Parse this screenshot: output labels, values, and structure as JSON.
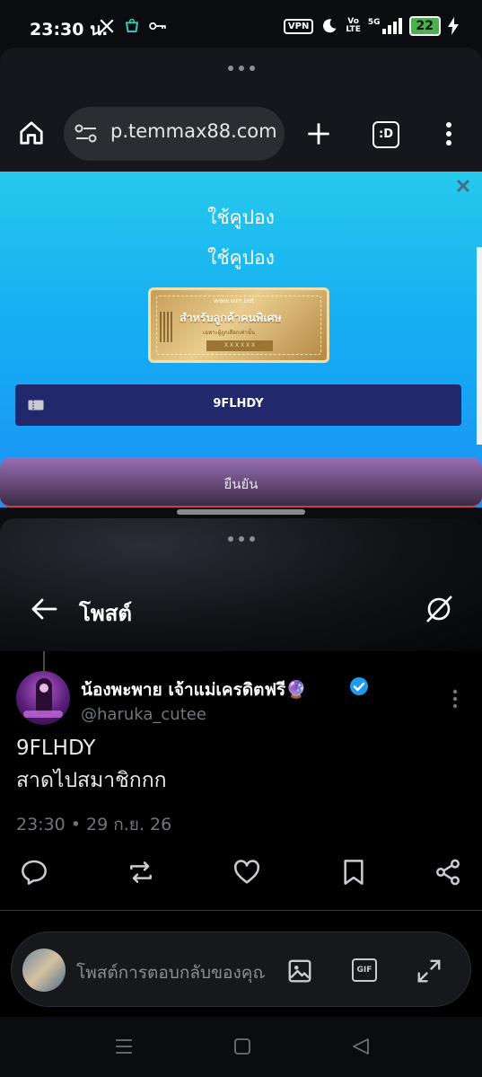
{
  "status_bar": {
    "time": "23:30 น.",
    "vpn": "VPN",
    "volte_top": "Vo",
    "volte_bottom": "LTE",
    "network": "5G",
    "battery": "22"
  },
  "browser": {
    "url": "p.temmax88.com",
    "tab_count": ":D",
    "page": {
      "heading_1": "ใช้คูปอง",
      "heading_2": "ใช้คูปอง",
      "ticket": {
        "brand": "www.wm.bet",
        "headline": "สำหรับลูกค้าคนพิเศษ",
        "subline": "เฉพาะผู้ถูกเลือกเท่านั้น",
        "code_mask": "X X X X X X"
      },
      "coupon_code": "9FLHDY",
      "confirm_label": "ยืนยัน"
    }
  },
  "x_post": {
    "header_title": "โพสต์",
    "author": {
      "display_name": "น้องพะพาย เจ้าแม่เครดิตฟรี🔮",
      "handle": "@haruka_cutee"
    },
    "text_line_1": "9FLHDY",
    "text_line_2": "สาดไปสมาชิกกก",
    "timestamp": "23:30 • 29 ก.ย. 26",
    "reply_placeholder": "โพสต์การตอบกลับของคุณ",
    "gif_label": "GIF"
  },
  "colors": {
    "page_gradient_top": "#25c9ec",
    "code_bar": "#22286b",
    "verified": "#1d9bf0"
  }
}
